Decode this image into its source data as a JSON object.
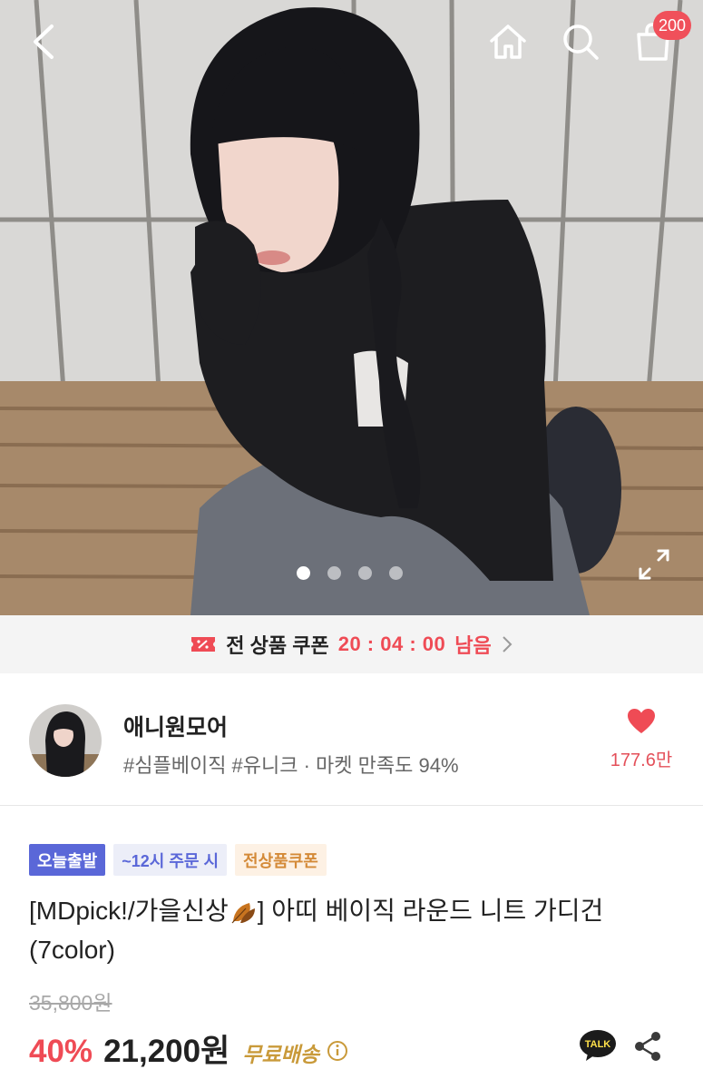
{
  "header": {
    "back_icon": "chevron-left-icon",
    "home_icon": "home-icon",
    "search_icon": "search-icon",
    "cart_icon": "shopping-bag-icon",
    "cart_count": "200"
  },
  "gallery": {
    "image_description_icon": "product-photo",
    "page_count": 4,
    "active_page": 1,
    "expand_icon": "expand-icon"
  },
  "coupon": {
    "label": "전 상품 쿠폰",
    "timer": "20 : 04 : 00",
    "suffix": "남음",
    "icon": "coupon-ticket-icon",
    "accent": "#ef4b55"
  },
  "shop": {
    "name": "애니원모어",
    "tags": "#심플베이직 #유니크 · 마켓 만족도 94%",
    "like_count": "177.6만",
    "like_color": "#e4505a"
  },
  "product": {
    "badges": [
      "오늘출발",
      "~12시 주문 시",
      "전상품쿠폰"
    ],
    "title_part1": "[MDpick!/가을신상",
    "title_part2": "] 아띠 베이직 라운드 니트 가디건 (7color)",
    "original_price": "35,800원",
    "discount": "40%",
    "price": "21,200원",
    "shipping": "무료배송",
    "talk_label": "TALK"
  },
  "colors": {
    "brand_purple": "#5a67d8",
    "price_red": "#ef4b55",
    "shipping_gold": "#c99a3a"
  }
}
